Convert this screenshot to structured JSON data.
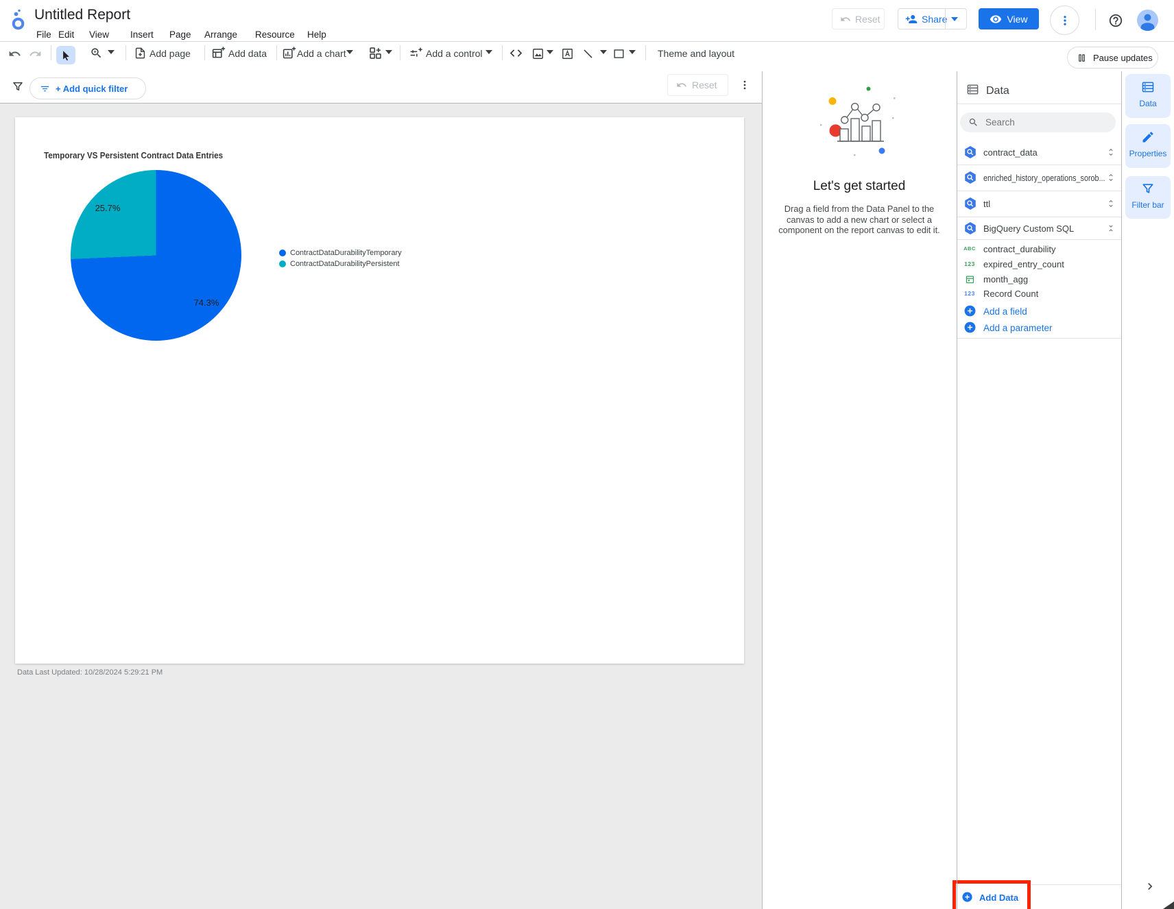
{
  "header": {
    "title": "Untitled Report",
    "menus": [
      "File",
      "Edit",
      "View",
      "Insert",
      "Page",
      "Arrange",
      "Resource",
      "Help"
    ],
    "reset_label": "Reset",
    "share_label": "Share",
    "view_label": "View"
  },
  "toolbar": {
    "add_page": "Add page",
    "add_data": "Add data",
    "add_chart": "Add a chart",
    "add_control": "Add a control",
    "theme_layout": "Theme and layout",
    "pause_updates": "Pause updates"
  },
  "filter_bar": {
    "add_quick_filter": "+ Add quick filter",
    "reset_label": "Reset"
  },
  "canvas": {
    "footer_note": "Data Last Updated: 10/28/2024 5:29:21 PM"
  },
  "chart_data": {
    "type": "pie",
    "title": "Temporary VS Persistent Contract Data Entries",
    "series": [
      {
        "label": "ContractDataDurabilityTemporary",
        "value_pct": 74.3,
        "display": "74.3%",
        "color": "#0067ee"
      },
      {
        "label": "ContractDataDurabilityPersistent",
        "value_pct": 25.7,
        "display": "25.7%",
        "color": "#00adc4"
      }
    ],
    "legend_position": "right"
  },
  "getting_started": {
    "heading": "Let's get started",
    "body_line1": "Drag a field from the Data Panel to the",
    "body_line2": "canvas to add a new chart or select a",
    "body_line3": "component on the report canvas to edit it."
  },
  "data_panel": {
    "title": "Data",
    "search_placeholder": "Search",
    "sources": [
      "contract_data",
      "enriched_history_operations_sorob...",
      "ttl",
      "BigQuery Custom SQL"
    ],
    "fields": [
      {
        "name": "contract_durability",
        "icon_text": "ABC"
      },
      {
        "name": "expired_entry_count",
        "icon_text": "123"
      },
      {
        "name": "month_agg",
        "icon_text": ""
      },
      {
        "name": "Record Count",
        "icon_text": "123"
      }
    ],
    "add_field": "Add a field",
    "add_parameter": "Add a parameter",
    "add_data": "Add Data"
  },
  "right_tabs": [
    {
      "label": "Data"
    },
    {
      "label": "Properties"
    },
    {
      "label": "Filter bar"
    }
  ]
}
